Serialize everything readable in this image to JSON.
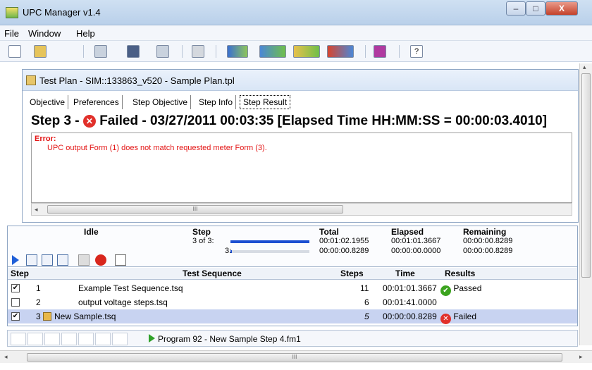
{
  "window": {
    "title": "UPC Manager v1.4",
    "min_label": "–",
    "max_label": "□",
    "close_label": "X"
  },
  "menu": {
    "items": [
      "File",
      "Window",
      "Help"
    ]
  },
  "toolbar": {
    "icons": [
      "new-file-icon",
      "open-folder-icon",
      "save-icon",
      "save-all-icon",
      "properties-icon",
      "print-icon",
      "connect-icon",
      "send-icon",
      "receive-icon",
      "sync-icon",
      "book-icon",
      "help-icon"
    ]
  },
  "document": {
    "title": "Test Plan - SIM::133863_v520 - Sample Plan.tpl",
    "tabs": [
      "Objective",
      "Preferences",
      "Step Objective",
      "Step Info",
      "Step Result"
    ],
    "active_tab": "Step Result",
    "heading_prefix": "Step 3 -",
    "heading_rest": "Failed - 03/27/2011 00:03:35 [Elapsed Time HH:MM:SS = 00:00:03.4010]",
    "fail_glyph": "✕",
    "error_label": "Error:",
    "error_message": "UPC output Form (1) does not match requested meter Form (3).",
    "scroll_grip": "III"
  },
  "runner": {
    "state": "Idle",
    "step_label": "Step",
    "step_count": "3 of 3:",
    "step_count_sub": "3:",
    "step_progress": 1.0,
    "sub_progress": 0.02,
    "total_label": "Total",
    "total_1": "00:01:02.1955",
    "total_2": "00:00:00.8289",
    "elapsed_label": "Elapsed",
    "elapsed_1": "00:01:01.3667",
    "elapsed_2": "00:00:00.0000",
    "remaining_label": "Remaining",
    "remaining_1": "00:00:00.8289",
    "remaining_2": "00:00:00.8289",
    "columns": {
      "step": "Step",
      "sequence": "Test Sequence",
      "steps": "Steps",
      "time": "Time",
      "results": "Results"
    },
    "rows": [
      {
        "checked": "✔",
        "num": "1",
        "name": "Example Test Sequence.tsq",
        "steps": "11",
        "time": "00:01:01.3667",
        "result": "Passed"
      },
      {
        "checked": "",
        "num": "2",
        "name": "output voltage steps.tsq",
        "steps": "6",
        "time": "00:01:41.0000",
        "result": ""
      },
      {
        "checked": "✔",
        "num": "3",
        "name": "New Sample.tsq",
        "steps": "5",
        "time": "00:00:00.8289",
        "result": "Failed"
      }
    ],
    "ok_glyph": "✔",
    "x_glyph": "✕"
  },
  "statusbar": {
    "text": "Program 92 - New Sample Step 4.fm1"
  },
  "bottom_scroll": {
    "grip": "III",
    "left": "◂",
    "right": "▸"
  }
}
